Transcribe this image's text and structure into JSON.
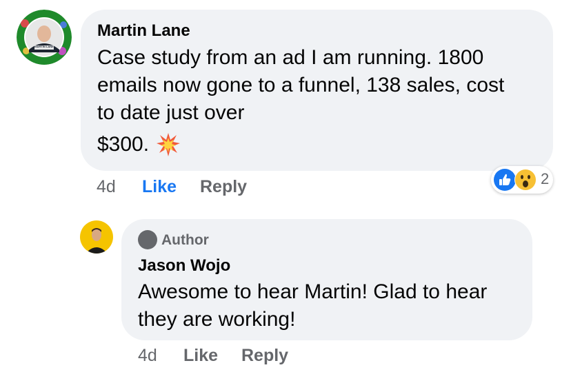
{
  "comment": {
    "author": "Martin Lane",
    "avatar_caption": "MARTIN LANE",
    "text_lines": [
      "Case study from an ad I am running. 1800",
      "emails now gone to a funnel, 138 sales, cost",
      "to date just over"
    ],
    "text_last": "$300.",
    "emoji": "collision-emoji",
    "time": "4d",
    "like_label": "Like",
    "reply_label": "Reply",
    "reactions": {
      "icons": [
        "like-reaction-icon",
        "wow-reaction-icon"
      ],
      "count": "2"
    }
  },
  "reply": {
    "badge": "Author",
    "author": "Jason Wojo",
    "text_lines": [
      "Awesome to hear Martin! Glad to hear",
      "they are working!"
    ],
    "time": "4d",
    "like_label": "Like",
    "reply_label": "Reply"
  },
  "colors": {
    "bubble": "#f0f2f5",
    "like_active": "#1877f2",
    "secondary_text": "#65676b",
    "avatar_ring": "#1f8a2b",
    "reply_avatar_bg": "#f5c400"
  }
}
